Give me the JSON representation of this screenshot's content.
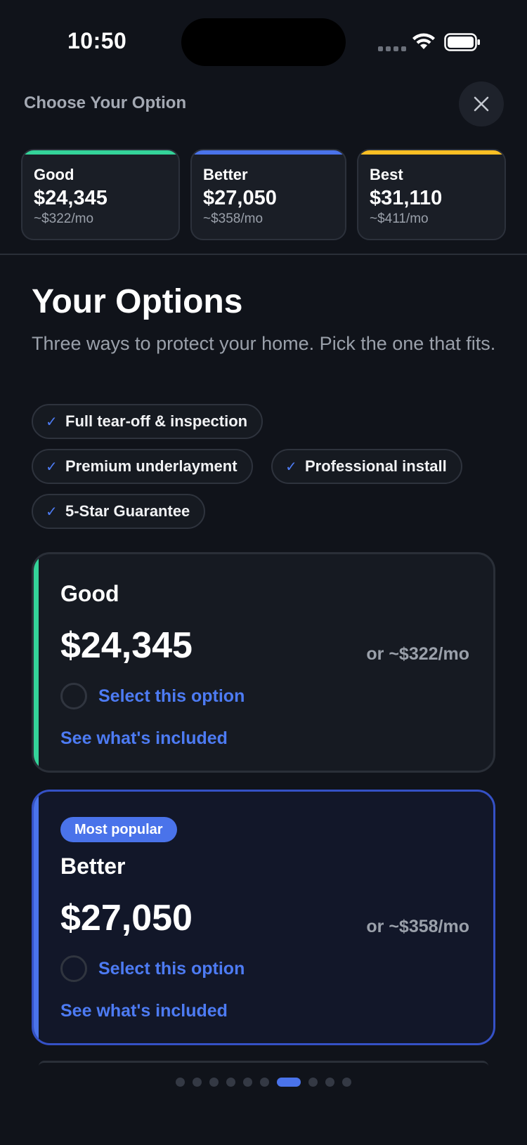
{
  "status_bar": {
    "time": "10:50"
  },
  "header": {
    "title": "Choose Your Option"
  },
  "tiers": [
    {
      "name": "Good",
      "price": "$24,345",
      "monthly": "~$322/mo",
      "color": "#34d399"
    },
    {
      "name": "Better",
      "price": "$27,050",
      "monthly": "~$358/mo",
      "color": "#4a73ea"
    },
    {
      "name": "Best",
      "price": "$31,110",
      "monthly": "~$411/mo",
      "color": "#fbbf24"
    }
  ],
  "main": {
    "title": "Your Options",
    "subtitle": "Three ways to protect your home. Pick the one that fits."
  },
  "features": [
    "Full tear-off & inspection",
    "Premium underlayment",
    "Professional install",
    "5-Star Guarantee"
  ],
  "options": [
    {
      "name": "Good",
      "price": "$24,345",
      "monthly": "or ~$322/mo",
      "select_label": "Select this option",
      "include_label": "See what's included",
      "accent": "#34d399"
    },
    {
      "name": "Better",
      "badge": "Most popular",
      "price": "$27,050",
      "monthly": "or ~$358/mo",
      "select_label": "Select this option",
      "include_label": "See what's included",
      "accent": "#4a73ea"
    }
  ],
  "pagination": {
    "total": 10,
    "active_index": 6
  },
  "colors": {
    "accent_blue": "#4a73ea",
    "link_blue": "#4d7bf3",
    "background": "#10131a"
  }
}
